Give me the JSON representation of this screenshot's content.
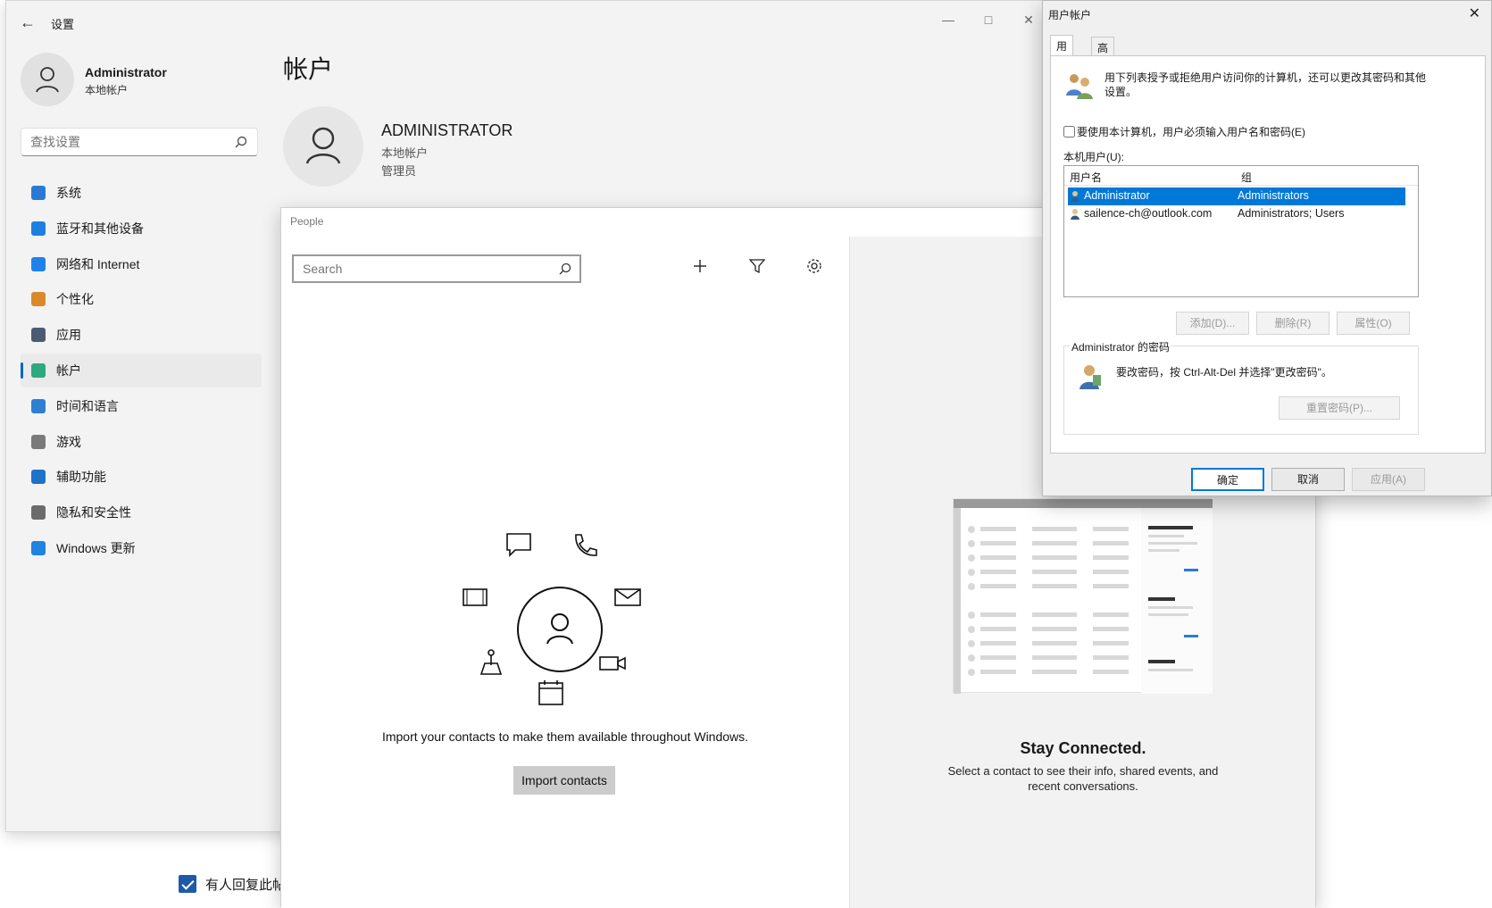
{
  "background": {
    "checkbox_label": "有人回复此帖子"
  },
  "settings": {
    "title": "设置",
    "profile": {
      "name": "Administrator",
      "type": "本地帐户"
    },
    "search_placeholder": "查找设置",
    "nav": [
      {
        "label": "系统",
        "icon": "system-icon",
        "color": "#2a7ad5"
      },
      {
        "label": "蓝牙和其他设备",
        "icon": "bluetooth-icon",
        "color": "#1f7fe0"
      },
      {
        "label": "网络和 Internet",
        "icon": "wifi-icon",
        "color": "#1f82e8"
      },
      {
        "label": "个性化",
        "icon": "brush-icon",
        "color": "#d88a2a"
      },
      {
        "label": "应用",
        "icon": "apps-icon",
        "color": "#4a5b73"
      },
      {
        "label": "帐户",
        "icon": "account-icon",
        "color": "#2da87f"
      },
      {
        "label": "时间和语言",
        "icon": "clock-globe-icon",
        "color": "#2d7fd2"
      },
      {
        "label": "游戏",
        "icon": "gamepad-icon",
        "color": "#7a7a7a"
      },
      {
        "label": "辅助功能",
        "icon": "accessibility-icon",
        "color": "#1d73c8"
      },
      {
        "label": "隐私和安全性",
        "icon": "shield-icon",
        "color": "#6b6b6b"
      },
      {
        "label": "Windows 更新",
        "icon": "update-icon",
        "color": "#1f83e0"
      }
    ],
    "active_nav_index": 5,
    "page_title": "帐户",
    "account": {
      "name": "ADMINISTRATOR",
      "type": "本地帐户",
      "role": "管理员"
    }
  },
  "people": {
    "title": "People",
    "search_placeholder": "Search",
    "import_text": "Import your contacts to make them available throughout Windows.",
    "import_button": "Import contacts",
    "stay_title": "Stay Connected.",
    "stay_text": "Select a contact to see their info, shared events, and recent conversations."
  },
  "user_accounts": {
    "title": "用户帐户",
    "tabs": [
      "用户",
      "高级"
    ],
    "description": "用下列表授予或拒绝用户访问你的计算机，还可以更改其密码和其他设置。",
    "checkbox_label": "要使用本计算机，用户必须输入用户名和密码(E)",
    "local_users_label": "本机用户(U):",
    "columns": [
      "用户名",
      "组"
    ],
    "rows": [
      {
        "user": "Administrator",
        "group": "Administrators"
      },
      {
        "user": "sailence-ch@outlook.com",
        "group": "Administrators; Users"
      }
    ],
    "buttons": {
      "add": "添加(D)...",
      "remove": "删除(R)",
      "properties": "属性(O)"
    },
    "password_group_label": "Administrator 的密码",
    "password_text": "要改密码，按 Ctrl-Alt-Del 并选择\"更改密码\"。",
    "reset_button": "重置密码(P)...",
    "ok": "确定",
    "cancel": "取消",
    "apply": "应用(A)"
  }
}
